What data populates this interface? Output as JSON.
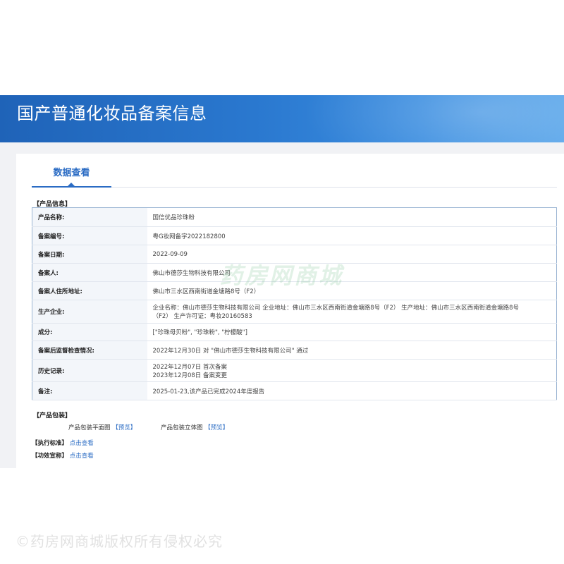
{
  "banner": {
    "title": "国产普通化妆品备案信息"
  },
  "tab": {
    "label": "数据查看"
  },
  "product_info": {
    "section_label": "【产品信息】",
    "rows": [
      {
        "key": "产品名称:",
        "value": "国信优品珍珠粉"
      },
      {
        "key": "备案编号:",
        "value": "粤G妆网备字2022182800"
      },
      {
        "key": "备案日期:",
        "value": "2022-09-09"
      },
      {
        "key": "备案人:",
        "value": "佛山市德莎生物科技有限公司"
      },
      {
        "key": "备案人住所地址:",
        "value": "佛山市三水区西南街道金塘路8号（F2）"
      },
      {
        "key": "生产企业:",
        "value": "企业名称：佛山市德莎生物科技有限公司 企业地址：佛山市三水区西南街道金塘路8号（F2） 生产地址：佛山市三水区西南街道金塘路8号",
        "value2": "（F2） 生产许可证：粤妆20160583"
      },
      {
        "key": "成分:",
        "value": "[\"珍珠母贝粉\", \"珍珠粉\", \"柠檬酸\"]"
      },
      {
        "key": "备案后监督检查情况:",
        "value": "2022年12月30日 对 \"佛山市德莎生物科技有限公司\" 通过"
      },
      {
        "key": "历史记录:",
        "value": "2022年12月07日 首次备案",
        "value2": "2023年12月08日 备案变更"
      },
      {
        "key": "备注:",
        "value": "2025-01-23,该产品已完成2024年度报告"
      }
    ]
  },
  "packaging": {
    "section_label": "【产品包装】",
    "flat_label": "产品包装平面图",
    "flat_link": "【预览】",
    "stereo_label": "产品包装立体图",
    "stereo_link": "【预览】"
  },
  "standard": {
    "label": "【执行标准】",
    "link": "点击查看"
  },
  "efficacy": {
    "label": "【功效宣称】",
    "link": "点击查看"
  },
  "watermark": {
    "text": "药房网商城"
  },
  "footer": {
    "text": "©药房网商城版权所有侵权必究"
  }
}
